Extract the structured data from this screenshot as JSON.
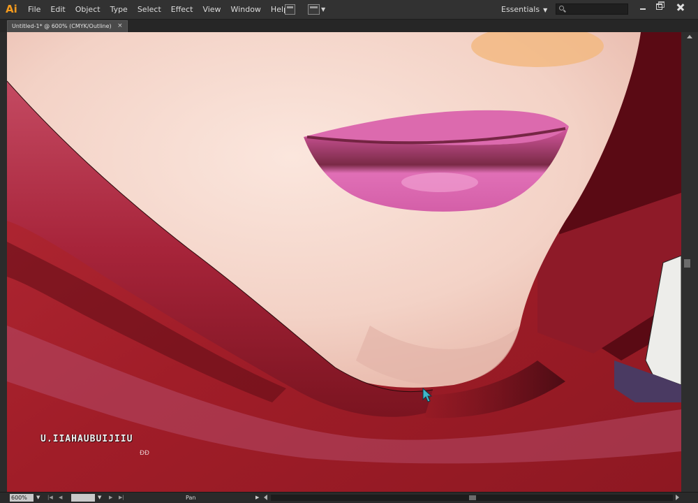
{
  "app": {
    "logo": "Ai",
    "menu": [
      "File",
      "Edit",
      "Object",
      "Type",
      "Select",
      "Effect",
      "View",
      "Window",
      "Help"
    ],
    "workspace": "Essentials",
    "search_placeholder": "",
    "accent_color": "#f39a1e"
  },
  "document": {
    "tab_title": "Untitled-1* @ 600% (CMYK/Outline)",
    "close_glyph": "×"
  },
  "canvas": {
    "watermark_title": "U.IIAHAUBUIJIIU",
    "watermark_sub": "ĐĐ"
  },
  "status": {
    "zoom": "600%",
    "tool": "Pan"
  },
  "icons": {
    "bridge": "bridge-icon",
    "arrange": "arrange-documents-icon",
    "search": "search-icon",
    "cursor": "arrow-cursor-icon"
  }
}
